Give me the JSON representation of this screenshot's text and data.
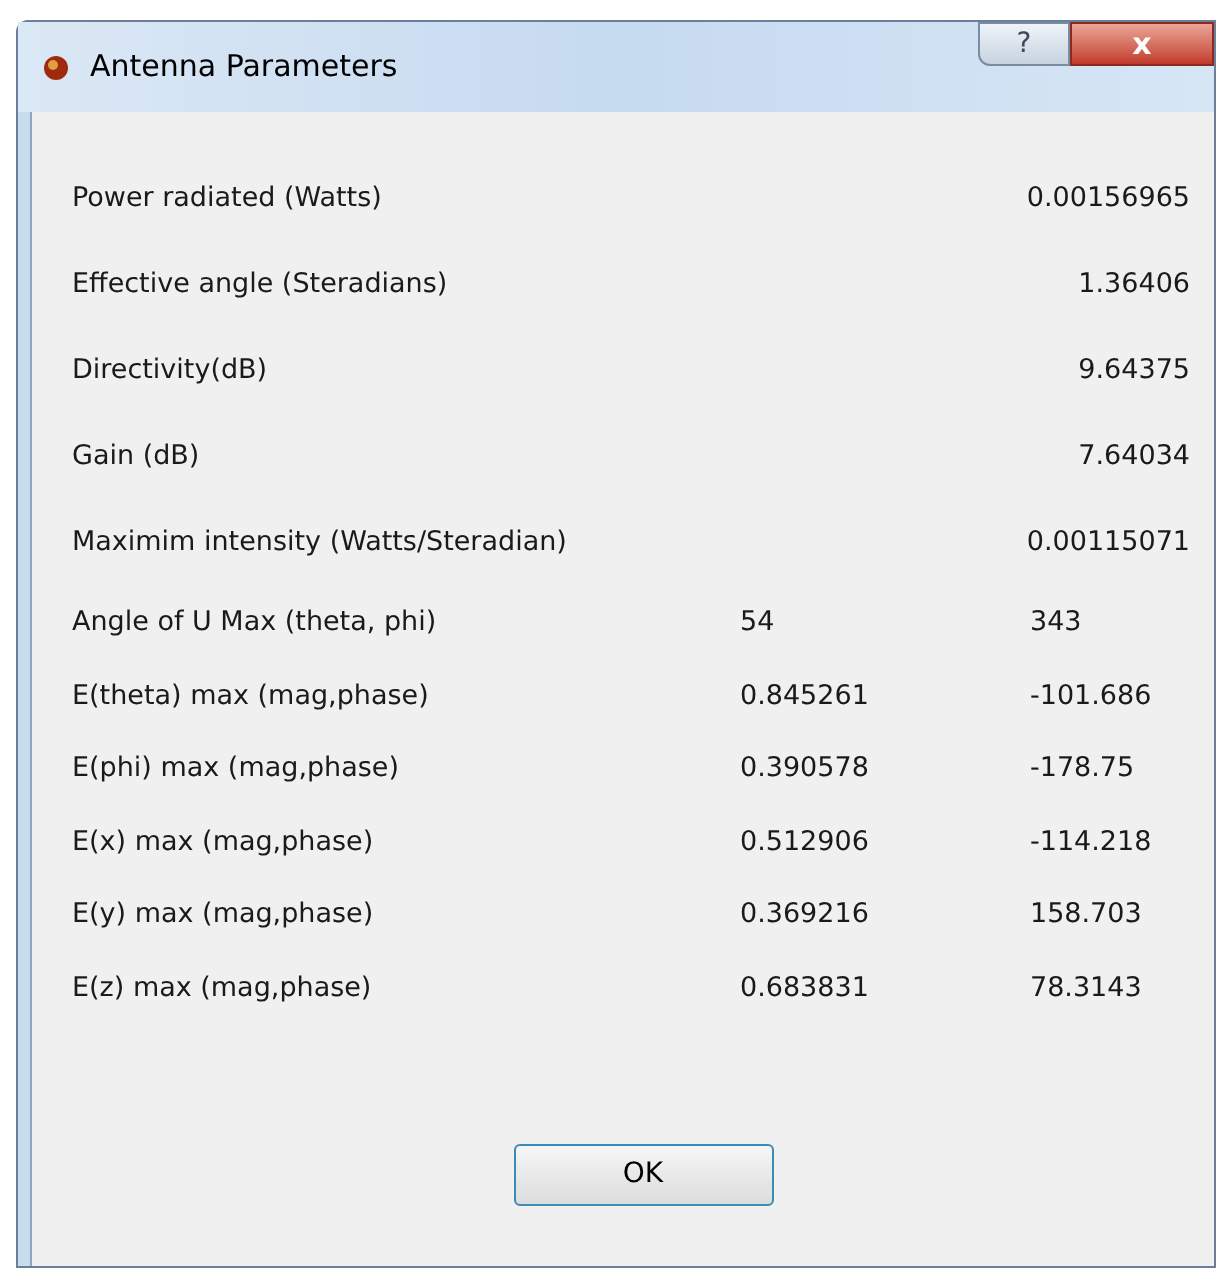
{
  "window": {
    "title": "Antenna Parameters"
  },
  "rows": [
    {
      "kind": "single",
      "label": "Power radiated (Watts)",
      "value": "0.00156965"
    },
    {
      "kind": "single",
      "label": "Effective angle (Steradians)",
      "value": "1.36406"
    },
    {
      "kind": "single",
      "label": "Directivity(dB)",
      "value": "9.64375"
    },
    {
      "kind": "single",
      "label": "Gain (dB)",
      "value": "7.64034"
    },
    {
      "kind": "single",
      "label": "Maximim intensity (Watts/Steradian)",
      "value": "0.00115071"
    },
    {
      "kind": "pair",
      "label": "Angle of U Max (theta, phi)",
      "values": [
        "54",
        "343"
      ]
    },
    {
      "kind": "pair",
      "label": "E(theta) max (mag,phase)",
      "values": [
        "0.845261",
        "-101.686"
      ]
    },
    {
      "kind": "pair",
      "label": "E(phi) max (mag,phase)",
      "values": [
        "0.390578",
        "-178.75"
      ]
    },
    {
      "kind": "pair",
      "label": "E(x) max (mag,phase)",
      "values": [
        "0.512906",
        "-114.218"
      ]
    },
    {
      "kind": "pair",
      "label": "E(y) max (mag,phase)",
      "values": [
        "0.369216",
        "158.703"
      ]
    },
    {
      "kind": "pair",
      "label": "E(z) max (mag,phase)",
      "values": [
        "0.683831",
        "78.3143"
      ]
    }
  ],
  "buttons": [
    "OK"
  ],
  "title_buttons": [
    "?",
    "x"
  ]
}
